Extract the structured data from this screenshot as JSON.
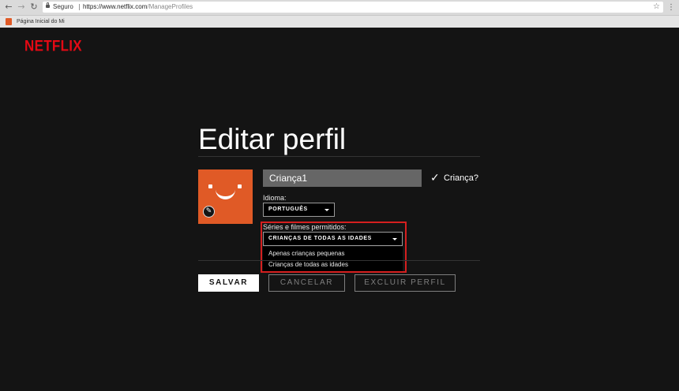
{
  "browser": {
    "secure_label": "Seguro",
    "url_host": "https://www.netflix.com",
    "url_path": "/ManageProfiles",
    "bookmark_label": "Página Inicial do Mi"
  },
  "brand": {
    "logo_text": "NETFLIX",
    "logo_color": "#e50914"
  },
  "page": {
    "title": "Editar perfil"
  },
  "profile": {
    "name_value": "Criança1",
    "avatar_color": "#e05a26",
    "kid_checked": true,
    "kid_label": "Criança?"
  },
  "language": {
    "label": "Idioma:",
    "selected": "PORTUGUÊS"
  },
  "maturity": {
    "label": "Séries e filmes permitidos:",
    "selected": "CRIANÇAS DE TODAS AS IDADES",
    "options": [
      "Apenas crianças pequenas",
      "Crianças de todas as idades"
    ],
    "highlight_color": "#d51f1f"
  },
  "buttons": {
    "save": "SALVAR",
    "cancel": "CANCELAR",
    "delete": "EXCLUIR PERFIL"
  }
}
